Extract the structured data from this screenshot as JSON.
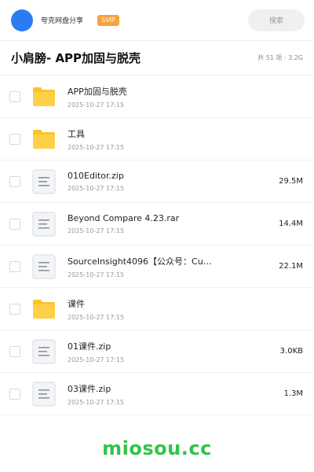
{
  "topbar": {
    "user_name": "夸克网盘分享",
    "badge": "SVIP",
    "search_placeholder": "搜索"
  },
  "header": {
    "title": "小肩膀- APP加固与脱壳",
    "summary": "共 51 项 · 3.2G"
  },
  "files": [
    {
      "type": "folder",
      "name": "APP加固与脱壳",
      "time": "2025-10-27 17:15",
      "size": ""
    },
    {
      "type": "folder",
      "name": "工具",
      "time": "2025-10-27 17:15",
      "size": ""
    },
    {
      "type": "file",
      "name": "010Editor.zip",
      "time": "2025-10-27 17:15",
      "size": "29.5M"
    },
    {
      "type": "file",
      "name": "Beyond Compare 4.23.rar",
      "time": "2025-10-27 17:15",
      "size": "14.4M"
    },
    {
      "type": "file",
      "name": "SourceInsight4096【公众号：Cun…",
      "time": "2025-10-27 17:15",
      "size": "22.1M"
    },
    {
      "type": "folder",
      "name": "课件",
      "time": "2025-10-27 17:15",
      "size": ""
    },
    {
      "type": "file",
      "name": "01课件.zip",
      "time": "2025-10-27 17:15",
      "size": "3.0KB"
    },
    {
      "type": "file",
      "name": "03课件.zip",
      "time": "2025-10-27 17:15",
      "size": "1.3M"
    }
  ],
  "footer": {
    "watermark": "miosou.cc"
  },
  "colors": {
    "avatar": "#2b7bf3",
    "badge": "#f6a33b",
    "folder": "#fcc32c",
    "watermark": "#33c34a"
  }
}
